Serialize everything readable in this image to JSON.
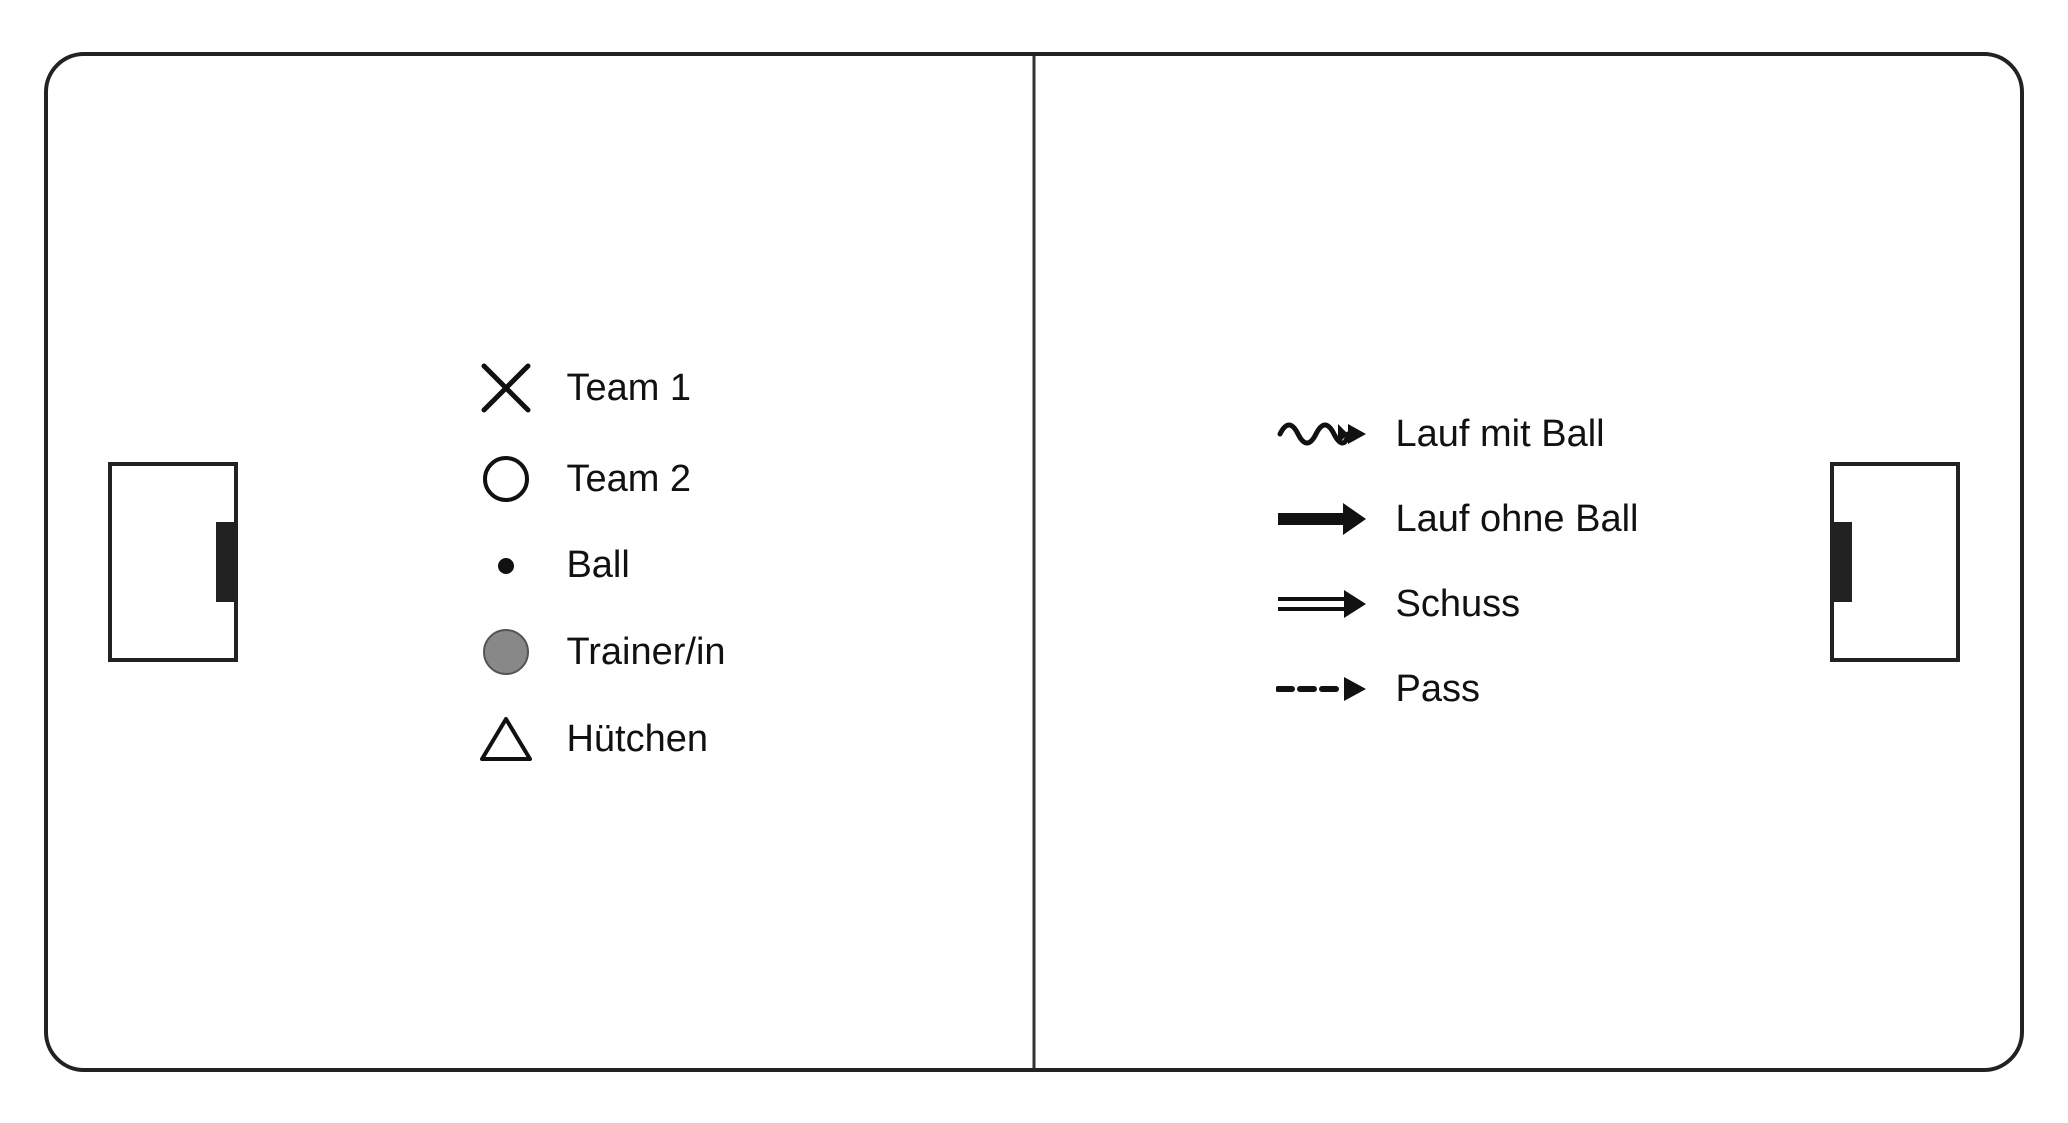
{
  "legend": {
    "left": {
      "items": [
        {
          "id": "team1",
          "label": "Team 1",
          "symbol_type": "x"
        },
        {
          "id": "team2",
          "label": "Team 2",
          "symbol_type": "circle"
        },
        {
          "id": "ball",
          "label": "Ball",
          "symbol_type": "dot"
        },
        {
          "id": "trainer",
          "label": "Trainer/in",
          "symbol_type": "gray-circle"
        },
        {
          "id": "hutchen",
          "label": "Hütchen",
          "symbol_type": "triangle"
        }
      ]
    },
    "right": {
      "items": [
        {
          "id": "lauf-mit-ball",
          "label": "Lauf mit Ball",
          "symbol_type": "wavy-arrow"
        },
        {
          "id": "lauf-ohne-ball",
          "label": "Lauf ohne Ball",
          "symbol_type": "solid-arrow"
        },
        {
          "id": "schuss",
          "label": "Schuss",
          "symbol_type": "double-arrow"
        },
        {
          "id": "pass",
          "label": "Pass",
          "symbol_type": "dashed-arrow"
        }
      ]
    }
  }
}
